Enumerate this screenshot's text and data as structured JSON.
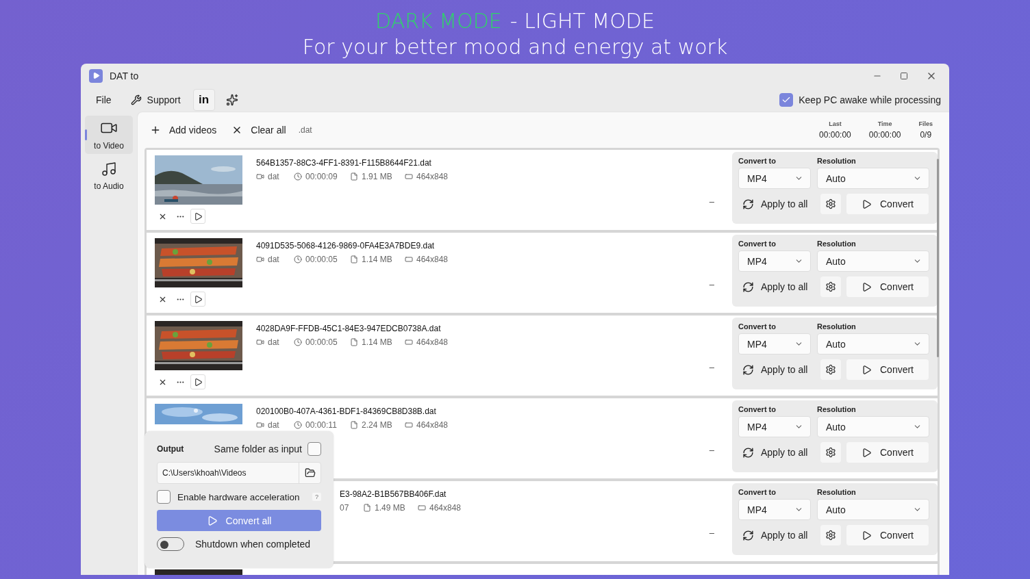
{
  "headline": [
    {
      "text": "DARK MODE",
      "kind": "accent"
    },
    {
      "text": "- LIGHT MODE",
      "kind": "plain"
    }
  ],
  "subheadline": "For your better mood and energy at work",
  "window": {
    "title": "DAT to"
  },
  "menu": {
    "file": "File",
    "support": "Support",
    "linkedin": "in"
  },
  "keep_awake": {
    "label": "Keep PC awake while processing",
    "checked": true
  },
  "nav": [
    {
      "label": "to Video",
      "selected": true
    },
    {
      "label": "to Audio",
      "selected": false
    }
  ],
  "toolbar": {
    "add": "Add videos",
    "clear": "Clear all",
    "extension": ".dat"
  },
  "stats": [
    {
      "label": "Last",
      "value": "00:00:00"
    },
    {
      "label": "Time",
      "value": "00:00:00"
    },
    {
      "label": "Files",
      "value": "0/9"
    }
  ],
  "rows": [
    {
      "kind": "full",
      "name": "564B1357-88C3-4FF1-8391-F115B8644F21.dat",
      "meta": [
        {
          "kind": "format",
          "text": "dat"
        },
        {
          "kind": "duration",
          "text": "00:00:09"
        },
        {
          "kind": "size",
          "text": "1.91 MB"
        },
        {
          "kind": "resolution",
          "text": "464x848"
        }
      ],
      "progress": "–",
      "convert_label": "Convert to",
      "format": "MP4",
      "resolution_label": "Resolution",
      "resolution": "Auto",
      "apply": "Apply to all",
      "convert": "Convert"
    },
    {
      "kind": "full",
      "name": "4091D535-5068-4126-9869-0FA4E3A7BDE9.dat",
      "meta": [
        {
          "kind": "format",
          "text": "dat"
        },
        {
          "kind": "duration",
          "text": "00:00:05"
        },
        {
          "kind": "size",
          "text": "1.14 MB"
        },
        {
          "kind": "resolution",
          "text": "464x848"
        }
      ],
      "progress": "–",
      "convert_label": "Convert to",
      "format": "MP4",
      "resolution_label": "Resolution",
      "resolution": "Auto",
      "apply": "Apply to all",
      "convert": "Convert"
    },
    {
      "kind": "full",
      "name": "4028DA9F-FFDB-45C1-84E3-947EDCB0738A.dat",
      "meta": [
        {
          "kind": "format",
          "text": "dat"
        },
        {
          "kind": "duration",
          "text": "00:00:05"
        },
        {
          "kind": "size",
          "text": "1.14 MB"
        },
        {
          "kind": "resolution",
          "text": "464x848"
        }
      ],
      "progress": "–",
      "convert_label": "Convert to",
      "format": "MP4",
      "resolution_label": "Resolution",
      "resolution": "Auto",
      "apply": "Apply to all",
      "convert": "Convert"
    },
    {
      "kind": "partly_covered",
      "name": "020100B0-407A-4361-BDF1-84369CB8D38B.dat",
      "meta": [
        {
          "kind": "format",
          "text": "dat"
        },
        {
          "kind": "duration",
          "text": "00:00:11"
        },
        {
          "kind": "size",
          "text": "2.24 MB"
        },
        {
          "kind": "resolution",
          "text": "464x848"
        }
      ],
      "progress": "–",
      "convert_label": "Convert to",
      "format": "MP4",
      "resolution_label": "Resolution",
      "resolution": "Auto",
      "apply": "Apply to all",
      "convert": "Convert"
    },
    {
      "kind": "covered",
      "name": "E3-98A2-B1B567BB406F.dat",
      "meta": [
        {
          "kind": "duration_cut",
          "text": "07"
        },
        {
          "kind": "size",
          "text": "1.49 MB"
        },
        {
          "kind": "resolution",
          "text": "464x848"
        }
      ],
      "progress": "–",
      "convert_label": "Convert to",
      "format": "MP4",
      "resolution_label": "Resolution",
      "resolution": "Auto",
      "apply": "Apply to all",
      "convert": "Convert"
    },
    {
      "kind": "cut"
    }
  ],
  "output": {
    "label": "Output",
    "same_folder": "Same folder as input",
    "same_folder_checked": false,
    "path": "C:\\Users\\khoah\\Videos",
    "hw_accel": "Enable hardware acceleration",
    "hw_accel_checked": false,
    "help": "?",
    "convert_all": "Convert all",
    "shutdown": "Shutdown when completed",
    "shutdown_on": false
  }
}
